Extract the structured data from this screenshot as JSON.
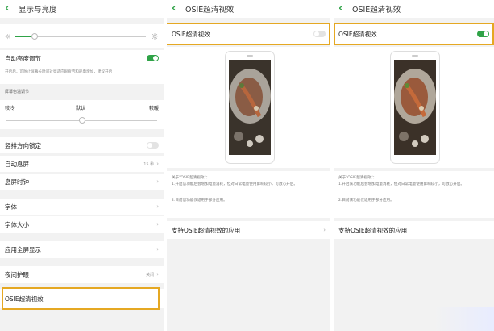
{
  "colors": {
    "accent": "#2fa347",
    "highlight": "#e5a823"
  },
  "panel1": {
    "back_icon": "chevron-left-icon",
    "title": "显示与亮度",
    "auto_brightness": "自动亮度调节",
    "auto_brightness_on": true,
    "auto_brightness_note": "开启后，可防止屏幕长时间对亮适应眼疲劳和耗电增加，建议开启",
    "color_temp_heading": "屏幕色温调节",
    "temp_cold": "较冷",
    "temp_default": "默认",
    "temp_warm": "较暖",
    "rotation_lock": "竖排方向锁定",
    "rotation_lock_on": false,
    "auto_lock": "自动息屏",
    "auto_lock_value": "15 秒",
    "screen_clock": "息屏时钟",
    "font": "字体",
    "font_size": "字体大小",
    "fullscreen_apps": "应用全屏显示",
    "night_mode": "夜间护眼",
    "night_mode_value": "关闭",
    "osie_item": "OSIE超清视效"
  },
  "panel2": {
    "title": "OSIE超清视效",
    "toggle_label": "OSIE超清视效",
    "toggle_on": false,
    "about_title": "关于\"OSIE超清视效\"：",
    "about_line1": "1.开启该功能后会增加电量消耗，但对日常电量使用影响较小，可放心开启。",
    "about_line2": "2.目前该功能仅适用于部分应用。",
    "supported_apps": "支持OSIE超清视效的应用"
  },
  "panel3": {
    "title": "OSIE超清视效",
    "toggle_label": "OSIE超清视效",
    "toggle_on": true,
    "about_title": "关于\"OSIE超清视效\"：",
    "about_line1": "1.开启该功能后会增加电量消耗，但对日常电量使用影响较小，可放心开启。",
    "about_line2": "2.目前该功能仅适用于部分应用。",
    "supported_apps": "支持OSIE超清视效的应用"
  }
}
